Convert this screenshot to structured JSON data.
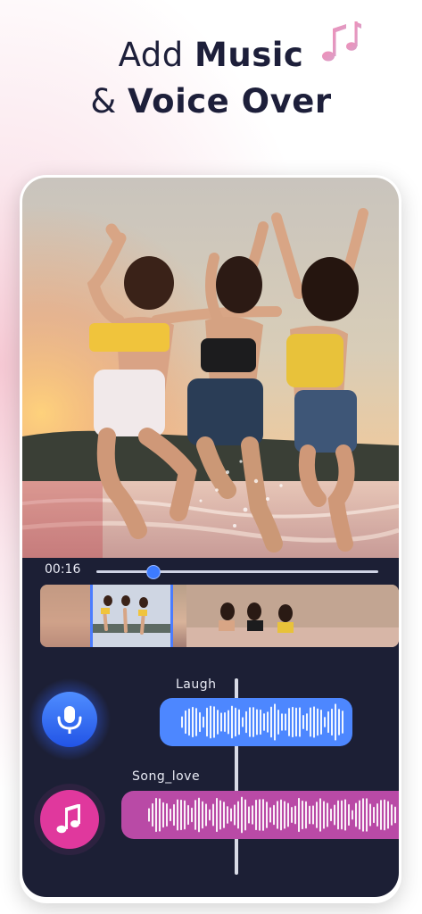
{
  "headline": {
    "line1_prefix": "Add",
    "line1_bold": "Music",
    "line2_prefix": "&",
    "line2_bold": "Voice Over"
  },
  "colors": {
    "accent_blue": "#3d7bff",
    "voice_clip": "#4d87ff",
    "music_clip": "#b94aa6",
    "music_button": "#e0389d",
    "editor_bg": "#1c1f35",
    "headline_text": "#1d1f3a"
  },
  "player": {
    "time": "00:16",
    "progress": 0.2
  },
  "tracks": {
    "voice": {
      "label": "Laugh",
      "icon": "microphone-icon"
    },
    "music": {
      "label": "Song_love",
      "icon": "music-note-icon"
    }
  },
  "decor": {
    "icon": "music-notes-icon"
  }
}
